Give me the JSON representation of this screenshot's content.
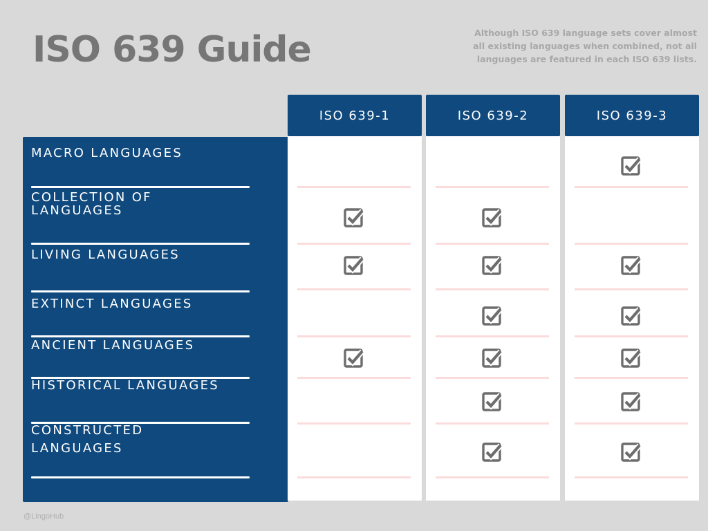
{
  "header": {
    "title": "ISO 639 Guide",
    "description": "Although ISO 639 language sets cover almost all existing languages when combined, not all languages are featured in each ISO 639 lists."
  },
  "columns": [
    {
      "label": "ISO 639-1"
    },
    {
      "label": "ISO 639-2"
    },
    {
      "label": "ISO 639-3"
    }
  ],
  "rows": [
    {
      "label": "MACRO LANGUAGES",
      "checks": [
        false,
        false,
        true
      ]
    },
    {
      "label": "COLLECTION OF LANGUAGES",
      "checks": [
        true,
        true,
        false
      ]
    },
    {
      "label": "LIVING LANGUAGES",
      "checks": [
        true,
        true,
        true
      ]
    },
    {
      "label": "EXTINCT LANGUAGES",
      "checks": [
        false,
        true,
        true
      ]
    },
    {
      "label": "ANCIENT LANGUAGES",
      "checks": [
        true,
        true,
        true
      ]
    },
    {
      "label": "HISTORICAL LANGUAGES",
      "checks": [
        false,
        true,
        true
      ]
    },
    {
      "label": "CONSTRUCTED LANGUAGES",
      "checks": [
        false,
        true,
        true
      ]
    }
  ],
  "icons": {
    "check": "checkbox-checked-icon"
  },
  "colors": {
    "background": "#d9d9d9",
    "panel": "#0f497d",
    "title": "#767676",
    "check": "#6d6d6d",
    "cell_rule": "#fbdcdc"
  },
  "footer": {
    "credit": "@LingoHub"
  }
}
